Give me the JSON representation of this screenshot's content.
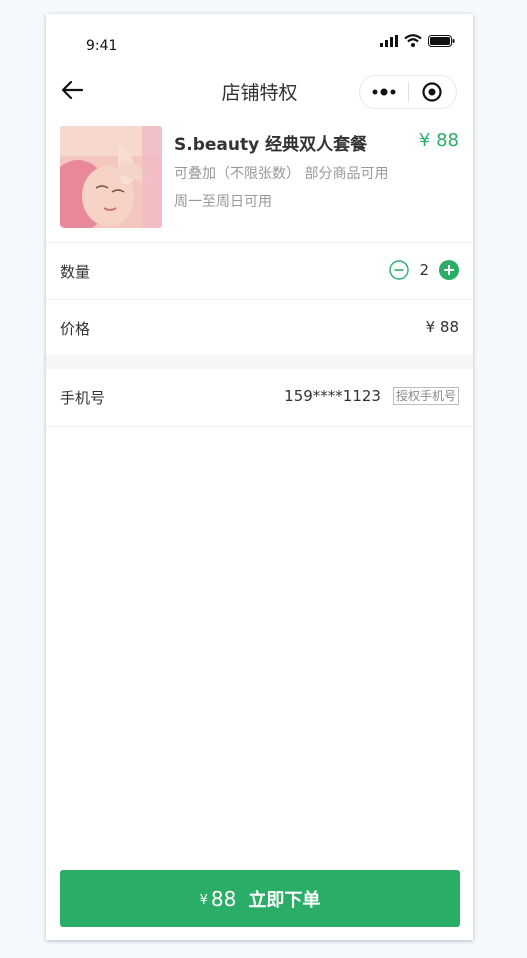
{
  "status": {
    "time": "9:41"
  },
  "nav": {
    "title": "店铺特权"
  },
  "product": {
    "name": "S.beauty  经典双人套餐",
    "price": "¥ 88",
    "desc_line1": "可叠加（不限张数） 部分商品可用",
    "desc_line2": "周一至周日可用"
  },
  "quantity": {
    "label": "数量",
    "value": "2"
  },
  "price_row": {
    "label": "价格",
    "value": "¥ 88"
  },
  "phone_row": {
    "label": "手机号",
    "value": "159****1123",
    "auth_button": "授权手机号"
  },
  "submit": {
    "currency": "¥",
    "amount": "88",
    "label": "立即下单"
  },
  "colors": {
    "accent": "#2aae67"
  }
}
